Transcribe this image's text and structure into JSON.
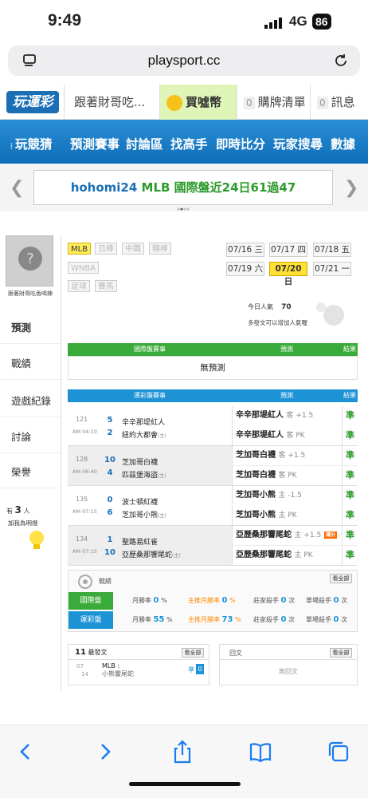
{
  "status": {
    "time": "9:49",
    "network": "4G",
    "battery": "86"
  },
  "browser": {
    "url": "playsport.cc"
  },
  "topnav": {
    "logo": "玩運彩",
    "user": "跟著財哥吃...",
    "coin": "買噓幣",
    "cart_count": "0",
    "cart": "購牌清單",
    "msg_count": "0",
    "msg": "訊息"
  },
  "mainnav": [
    "玩競猜",
    "預測賽事",
    "討論區",
    "找高手",
    "即時比分",
    "玩家搜尋",
    "數據"
  ],
  "banner": {
    "user": "hohomi24",
    "text": " MLB 國際盤近24日61過47"
  },
  "sidebar": {
    "name": "跟著財哥吃香喝辣",
    "menu": [
      "預測",
      "戰績",
      "遊戲紀錄",
      "討論",
      "榮譽"
    ],
    "fans_prefix": "有",
    "fans_count": "3",
    "fans_unit": "人",
    "fans_text": "加我為明燈"
  },
  "leagues": [
    "MLB",
    "日棒",
    "中職",
    "韓棒",
    "WNBA",
    "足球",
    "賽馬"
  ],
  "dates": [
    "07/16 三",
    "07/17 四",
    "07/18 五",
    "07/19 六",
    "07/20 日",
    "07/21 一"
  ],
  "popularity": {
    "label": "今日人氣",
    "value": "70",
    "hint": "多發文可以增加人氣喔"
  },
  "international": {
    "col_game": "國際盤賽事",
    "col_pick": "預測",
    "col_result": "結果",
    "empty": "無預測"
  },
  "lottery": {
    "col_game": "運彩盤賽事",
    "col_pick": "預測",
    "col_result": "結果",
    "games": [
      {
        "no": "121",
        "time": "AM 04:10",
        "away_score": "5",
        "away": "辛辛那堤紅人",
        "home_score": "2",
        "home": "紐約大都會",
        "home_tag": "(主)",
        "picks": [
          {
            "team": "辛辛那堤紅人",
            "side": "客 +1.5",
            "result": "準"
          },
          {
            "team": "辛辛那堤紅人",
            "side": "客 PK",
            "result": "準"
          }
        ]
      },
      {
        "no": "128",
        "time": "AM 06:40",
        "away_score": "10",
        "away": "芝加哥白襪",
        "home_score": "4",
        "home": "匹茲堡海盜",
        "home_tag": "(主)",
        "picks": [
          {
            "team": "芝加哥白襪",
            "side": "客 +1.5",
            "result": "準"
          },
          {
            "team": "芝加哥白襪",
            "side": "客 PK",
            "result": "準"
          }
        ]
      },
      {
        "no": "135",
        "time": "AM 07:15",
        "away_score": "0",
        "away": "波士頓紅襪",
        "home_score": "6",
        "home": "芝加哥小熊",
        "home_tag": "(主)",
        "picks": [
          {
            "team": "芝加哥小熊",
            "side": "主 -1.5",
            "result": "準"
          },
          {
            "team": "芝加哥小熊",
            "side": "主 PK",
            "result": "準"
          }
        ]
      },
      {
        "no": "134",
        "time": "AM 07:15",
        "away_score": "1",
        "away": "聖路易紅雀",
        "home_score": "10",
        "home": "亞歷桑那響尾蛇",
        "home_tag": "(主)",
        "picks": [
          {
            "team": "亞歷桑那響尾蛇",
            "side": "主 +1.5",
            "badge": "讓分",
            "result": "準"
          },
          {
            "team": "亞歷桑那響尾蛇",
            "side": "主 PK",
            "result": "準"
          }
        ]
      }
    ]
  },
  "record": {
    "title": "戰績",
    "see_all": "看全部",
    "rows": [
      {
        "label": "國際盤",
        "monthly": "月勝率",
        "monthly_val": "0",
        "home": "主推月勝率",
        "home_val": "0",
        "kill": "莊家殺手",
        "kill_val": "0",
        "kill_unit": "次",
        "single": "單場殺手",
        "single_val": "0",
        "single_unit": "次"
      },
      {
        "label": "運彩盤",
        "monthly": "月勝率",
        "monthly_val": "55",
        "home": "主推月勝率",
        "home_val": "73",
        "kill": "莊家殺手",
        "kill_val": "0",
        "kill_unit": "次",
        "single": "單場殺手",
        "single_val": "0",
        "single_unit": "次"
      }
    ],
    "pct": "%"
  },
  "latest": {
    "count": "11",
    "title": "最發文",
    "see_all": "看全部",
    "date_m": "07",
    "date_d": "14",
    "league": "MLB :",
    "subject": "小熊響尾蛇",
    "tag": "準",
    "num": "0"
  },
  "reply": {
    "title": "回文",
    "see_all": "看全部",
    "empty": "無回文"
  },
  "colors": {
    "green": "#3aab3a",
    "blue": "#1d93d6",
    "yellow": "#ffe033",
    "red": "#ff6b00"
  }
}
